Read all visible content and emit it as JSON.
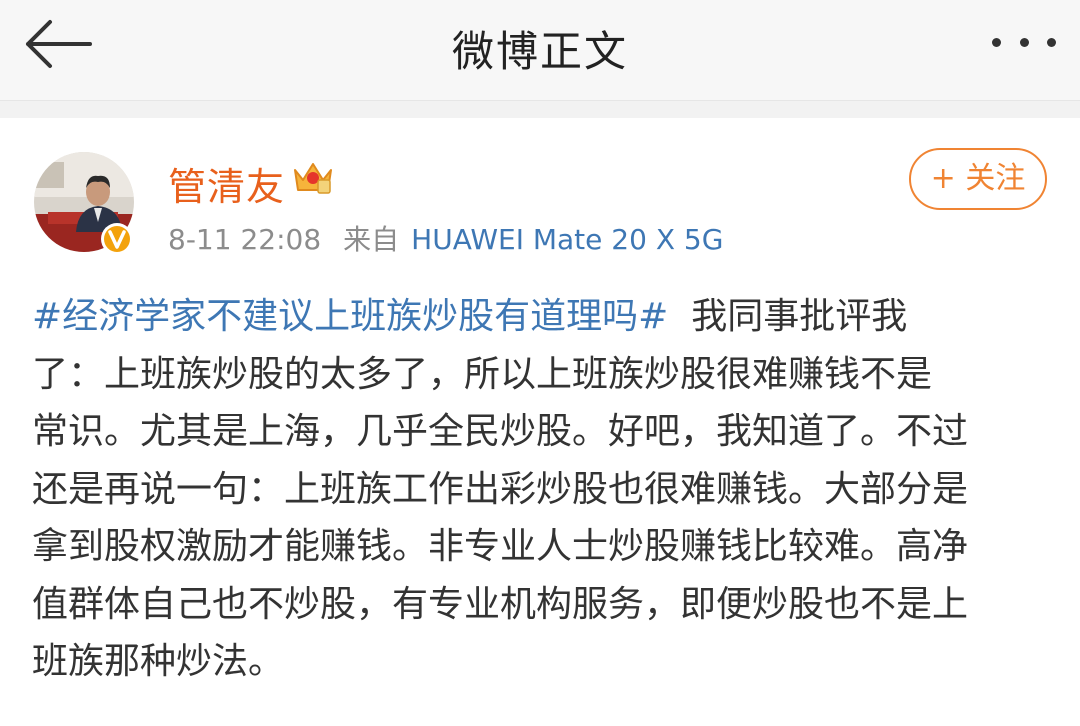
{
  "header": {
    "title": "微博正文",
    "icons": {
      "back": "arrow-left-icon",
      "more": "more-dots-icon"
    }
  },
  "post": {
    "author": {
      "name": "管清友",
      "badge_icon": "crown-member-icon",
      "verified_icon": "verified-v-icon"
    },
    "time": "8-11 22:08",
    "source_prefix": "来自",
    "device": "HUAWEI Mate 20 X 5G",
    "follow_label": "+ 关注",
    "hashtag": "#经济学家不建议上班族炒股有道理吗#",
    "lines": [
      "  我同事批评我",
      "了：上班族炒股的太多了，所以上班族炒股很难赚钱不是",
      "常识。尤其是上海，几乎全民炒股。好吧，我知道了。不过",
      "还是再说一句：上班族工作出彩炒股也很难赚钱。大部分是",
      "拿到股权激励才能赚钱。非专业人士炒股赚钱比较难。高净",
      "值群体自己也不炒股，有专业机构服务，即便炒股也不是上",
      "班族那种炒法。"
    ]
  },
  "colors": {
    "username": "#e8601c",
    "link": "#3e77b4",
    "follow": "#f08433",
    "meta": "#8c8c8c"
  }
}
